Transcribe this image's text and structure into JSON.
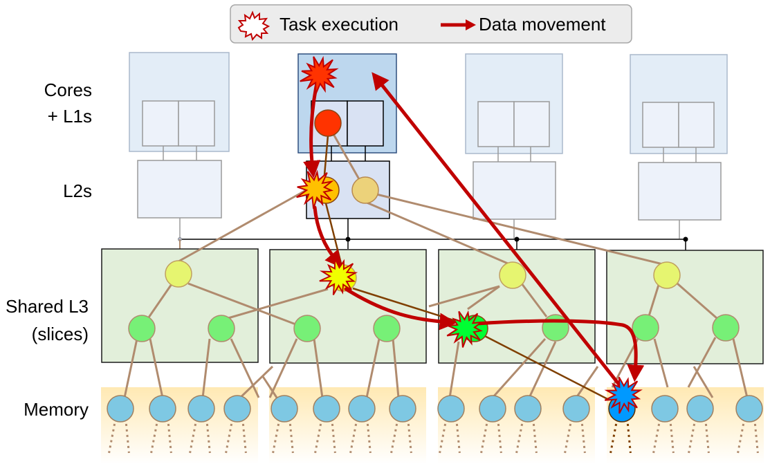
{
  "legend": {
    "task_execution_label": "Task execution",
    "data_movement_label": "Data movement",
    "task_icon": "starburst-icon",
    "movement_icon": "red-arrow-icon"
  },
  "row_labels": {
    "cores_line1": "Cores",
    "cores_line2": "+ L1s",
    "l2": "L2s",
    "l3_line1": "Shared L3",
    "l3_line2": "(slices)",
    "memory": "Memory"
  },
  "colors": {
    "arrow": "#c00000",
    "tree_edge": "#b08b6e",
    "active_edge": "#7f3f00",
    "core_bg": "#e3edf7",
    "core_active_bg": "#bdd7ee",
    "l3_bg": "#e2efda",
    "l3_node": "#e6f570",
    "l3_leaf": "#77f077",
    "mem_node": "#7ec8e3",
    "task_core": "#ff3300",
    "task_l2": "#ffc000",
    "task_l3": "#f0ff00",
    "task_l3_leaf": "#00ff33",
    "task_mem": "#0099ff"
  },
  "structure": {
    "cores": 4,
    "active_core": 1,
    "l3_slices": 4,
    "memory_banks_per_slice": 4
  }
}
